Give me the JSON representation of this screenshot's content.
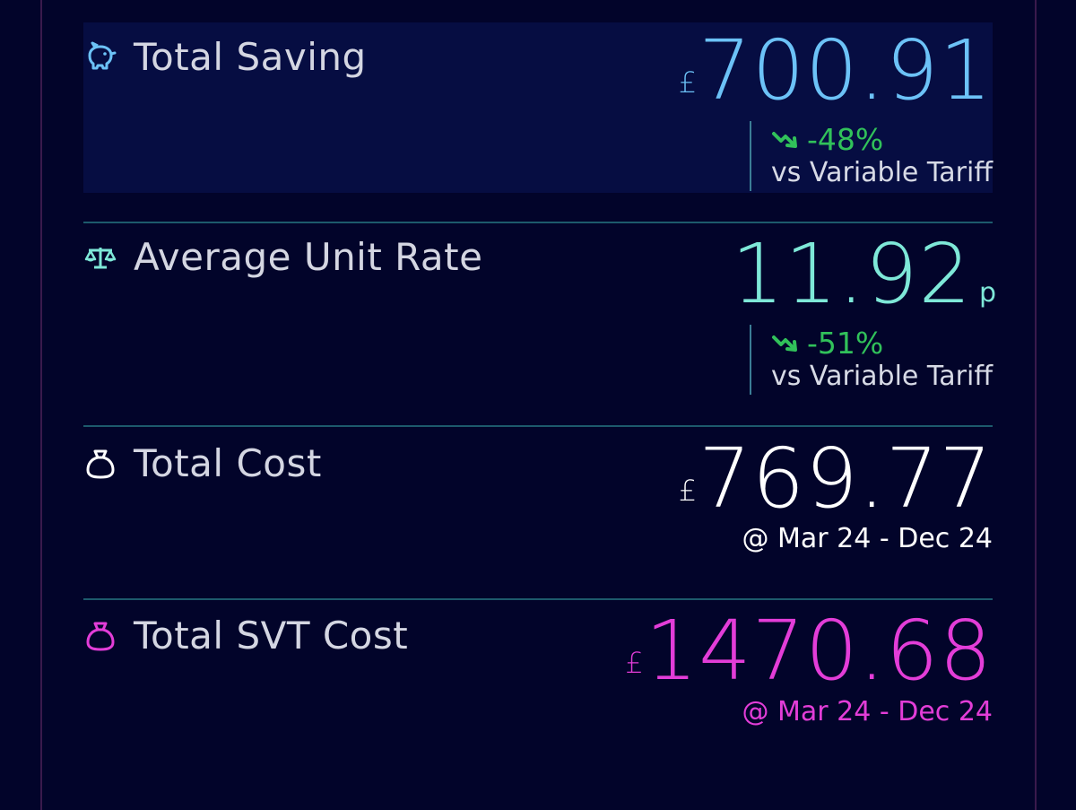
{
  "colors": {
    "background": "#02042a",
    "highlight_panel": "#060d42",
    "divider": "#1d5a6c",
    "saving_blue": "#6cc2f7",
    "rate_teal": "#7ee8d8",
    "cost_white": "#ffffff",
    "svt_magenta": "#e33dd8",
    "delta_green": "#31c15a"
  },
  "total_saving": {
    "label": "Total Saving",
    "icon": "piggy-bank-icon",
    "currency": "£",
    "value": "700.91",
    "delta": "-48%",
    "delta_icon": "trend-down-icon",
    "delta_label": "vs Variable Tariff"
  },
  "average_unit_rate": {
    "label": "Average Unit Rate",
    "icon": "scales-icon",
    "value": "11.92",
    "unit": "p",
    "delta": "-51%",
    "delta_icon": "trend-down-icon",
    "delta_label": "vs Variable Tariff"
  },
  "total_cost": {
    "label": "Total Cost",
    "icon": "money-bag-icon",
    "currency": "£",
    "value": "769.77",
    "period": "@ Mar 24 - Dec 24"
  },
  "total_svt_cost": {
    "label": "Total SVT Cost",
    "icon": "money-bag-icon",
    "currency": "£",
    "value": "1470.68",
    "period": "@ Mar 24 - Dec 24"
  }
}
